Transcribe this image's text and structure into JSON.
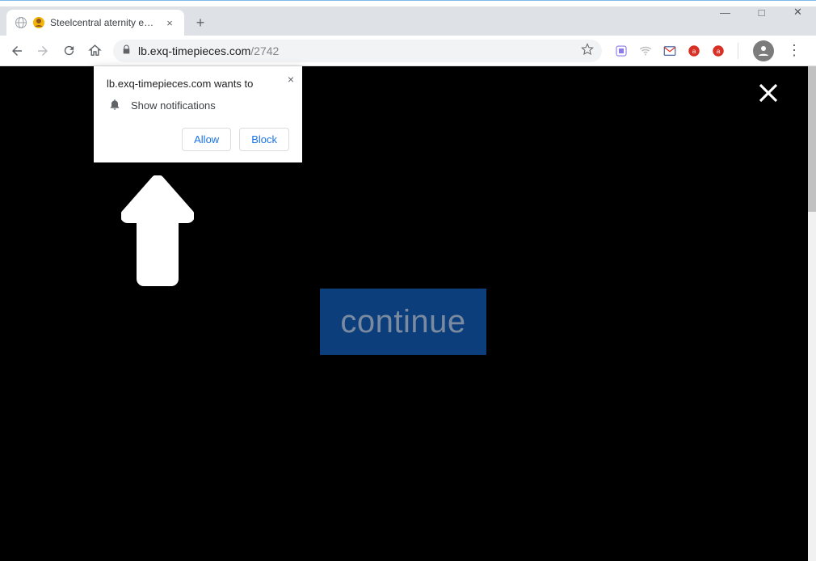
{
  "tab": {
    "title": "Steelcentral aternity extension",
    "close_glyph": "×"
  },
  "newtab_glyph": "+",
  "window": {
    "minimize_glyph": "—",
    "maximize_glyph": "□",
    "close_glyph": "✕"
  },
  "toolbar": {
    "url_host": "lb.exq-timepieces.com",
    "url_path": "/2742"
  },
  "notification": {
    "title": "lb.exq-timepieces.com wants to",
    "permission_label": "Show notifications",
    "allow_label": "Allow",
    "block_label": "Block",
    "close_glyph": "×"
  },
  "page": {
    "continue_label": "continue"
  }
}
